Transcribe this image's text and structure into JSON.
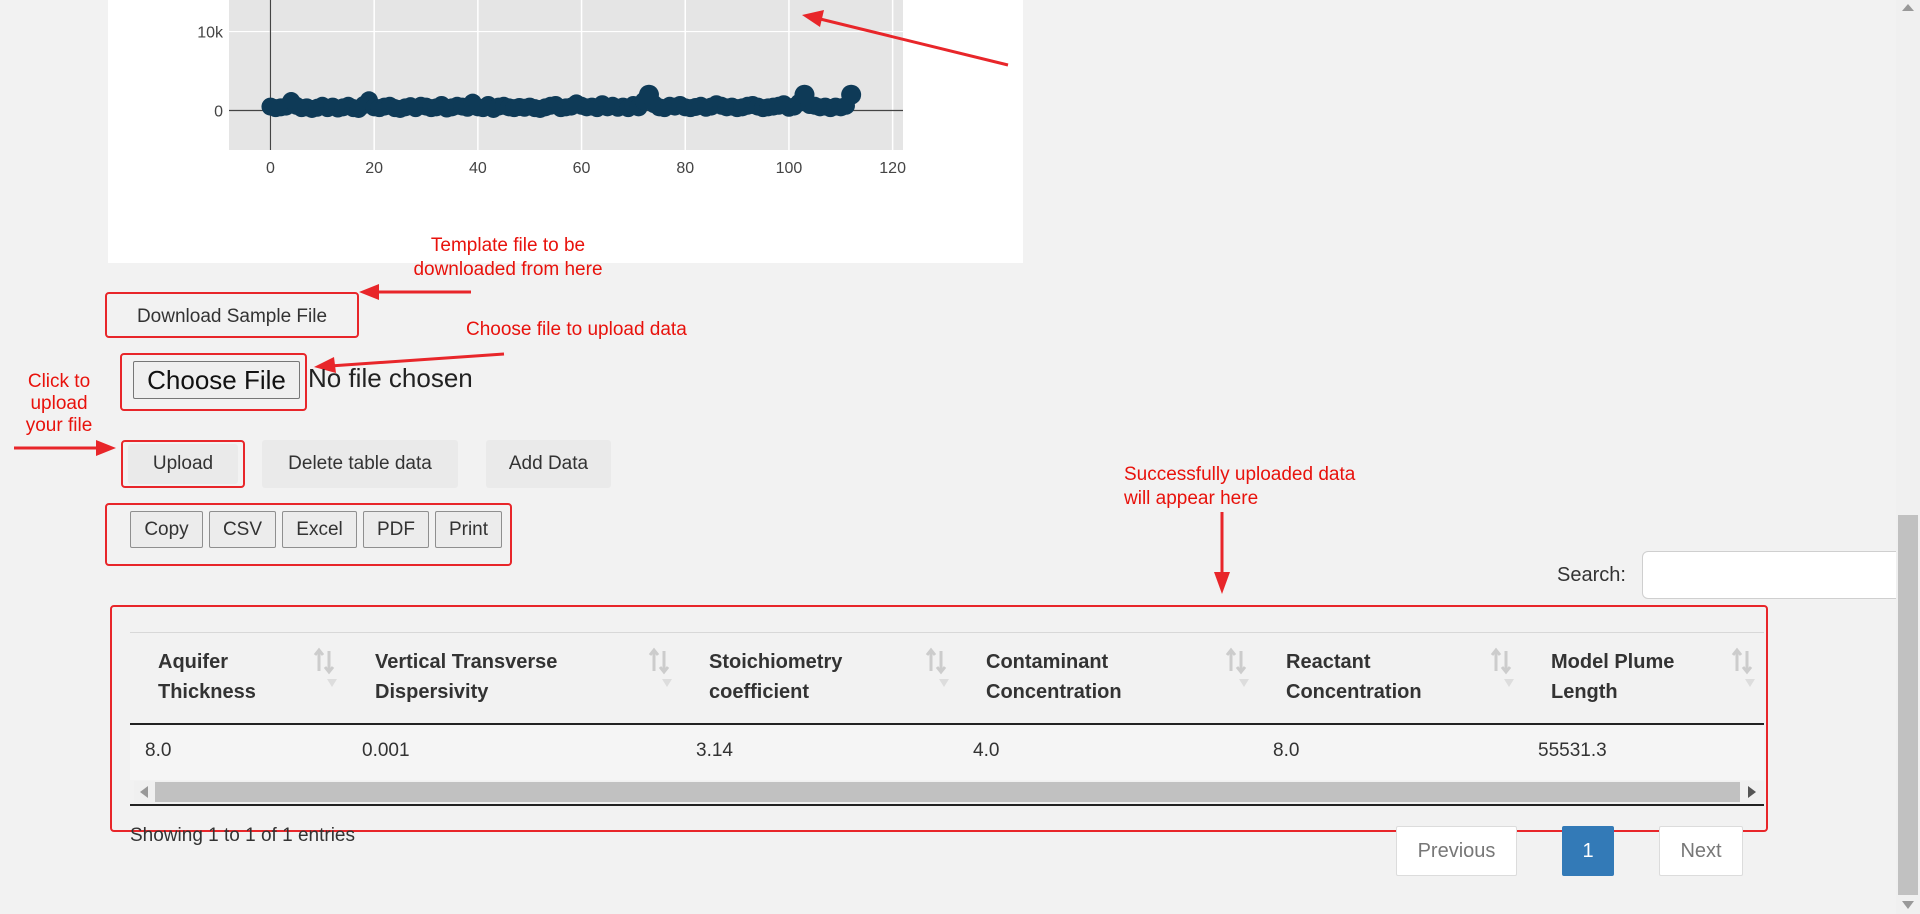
{
  "chart_data": {
    "type": "scatter",
    "title": "",
    "xlabel": "",
    "ylabel": "",
    "x_ticks": [
      "0",
      "20",
      "40",
      "60",
      "80",
      "100",
      "120"
    ],
    "y_ticks": [
      "0",
      "10k"
    ],
    "xlim": [
      -8,
      122
    ],
    "ylim": [
      -5000,
      14000
    ],
    "marker_color": "#0e3a57",
    "series": [
      {
        "x": [
          0,
          1,
          2,
          3,
          4,
          5,
          6,
          7,
          8,
          9,
          10,
          11,
          12,
          13,
          14,
          15,
          16,
          17,
          18,
          19,
          20,
          21,
          22,
          23,
          24,
          25,
          26,
          27,
          28,
          29,
          30,
          31,
          32,
          33,
          34,
          35,
          36,
          37,
          38,
          39,
          40,
          41,
          42,
          43,
          44,
          45,
          46,
          47,
          48,
          49,
          50,
          51,
          52,
          53,
          54,
          55,
          56,
          57,
          58,
          59,
          60,
          61,
          62,
          63,
          64,
          65,
          66,
          67,
          68,
          69,
          70,
          71,
          72,
          73,
          74,
          75,
          76,
          77,
          78,
          79,
          80,
          81,
          82,
          83,
          84,
          85,
          86,
          87,
          88,
          89,
          90,
          91,
          92,
          93,
          94,
          95,
          96,
          97,
          98,
          99,
          100,
          101,
          102,
          103,
          104,
          105,
          106,
          107,
          108,
          109,
          110,
          111,
          112
        ],
        "y": [
          500,
          300,
          400,
          500,
          1200,
          600,
          300,
          400,
          200,
          350,
          600,
          300,
          500,
          250,
          400,
          600,
          300,
          200,
          700,
          1300,
          400,
          300,
          500,
          600,
          300,
          200,
          400,
          550,
          300,
          600,
          500,
          300,
          400,
          700,
          250,
          400,
          600,
          500,
          350,
          1000,
          400,
          300,
          700,
          200,
          500,
          600,
          400,
          300,
          450,
          350,
          500,
          300,
          200,
          400,
          600,
          700,
          300,
          400,
          500,
          900,
          600,
          400,
          500,
          300,
          800,
          400,
          600,
          350,
          500,
          300,
          700,
          400,
          1200,
          2000,
          800,
          400,
          300,
          600,
          500,
          700,
          400,
          300,
          450,
          600,
          350,
          500,
          800,
          600,
          400,
          500,
          300,
          400,
          600,
          700,
          500,
          300,
          400,
          500,
          600,
          800,
          350,
          500,
          1000,
          2000,
          700,
          600,
          400,
          500,
          300,
          500,
          400,
          600,
          2000
        ]
      }
    ]
  },
  "buttons": {
    "download_sample": "Download Sample File",
    "choose_file": "Choose File",
    "file_status": "No file chosen",
    "upload": "Upload",
    "delete_table": "Delete table data",
    "add_data": "Add Data"
  },
  "export_buttons": [
    "Copy",
    "CSV",
    "Excel",
    "PDF",
    "Print"
  ],
  "annotations": {
    "template": [
      "Template file to be",
      "downloaded from here"
    ],
    "choose": "Choose file to upload data",
    "click_upload": [
      "Click to",
      "upload",
      "your file"
    ],
    "success": [
      "Successfully uploaded data",
      "will appear here"
    ],
    "color": "#e8120c"
  },
  "search": {
    "label": "Search:",
    "value": ""
  },
  "table": {
    "columns": [
      [
        "Aquifer",
        "Thickness"
      ],
      [
        "Vertical Transverse",
        "Dispersivity"
      ],
      [
        "Stoichiometry",
        "coefficient"
      ],
      [
        "Contaminant",
        "Concentration"
      ],
      [
        "Reactant",
        "Concentration"
      ],
      [
        "Model Plume",
        "Length"
      ]
    ],
    "rows": [
      [
        "8.0",
        "0.001",
        "3.14",
        "4.0",
        "8.0",
        "55531.3"
      ]
    ]
  },
  "info": "Showing 1 to 1 of 1 entries",
  "pagination": {
    "previous": "Previous",
    "current": "1",
    "next": "Next",
    "active_color": "#337ab7"
  }
}
